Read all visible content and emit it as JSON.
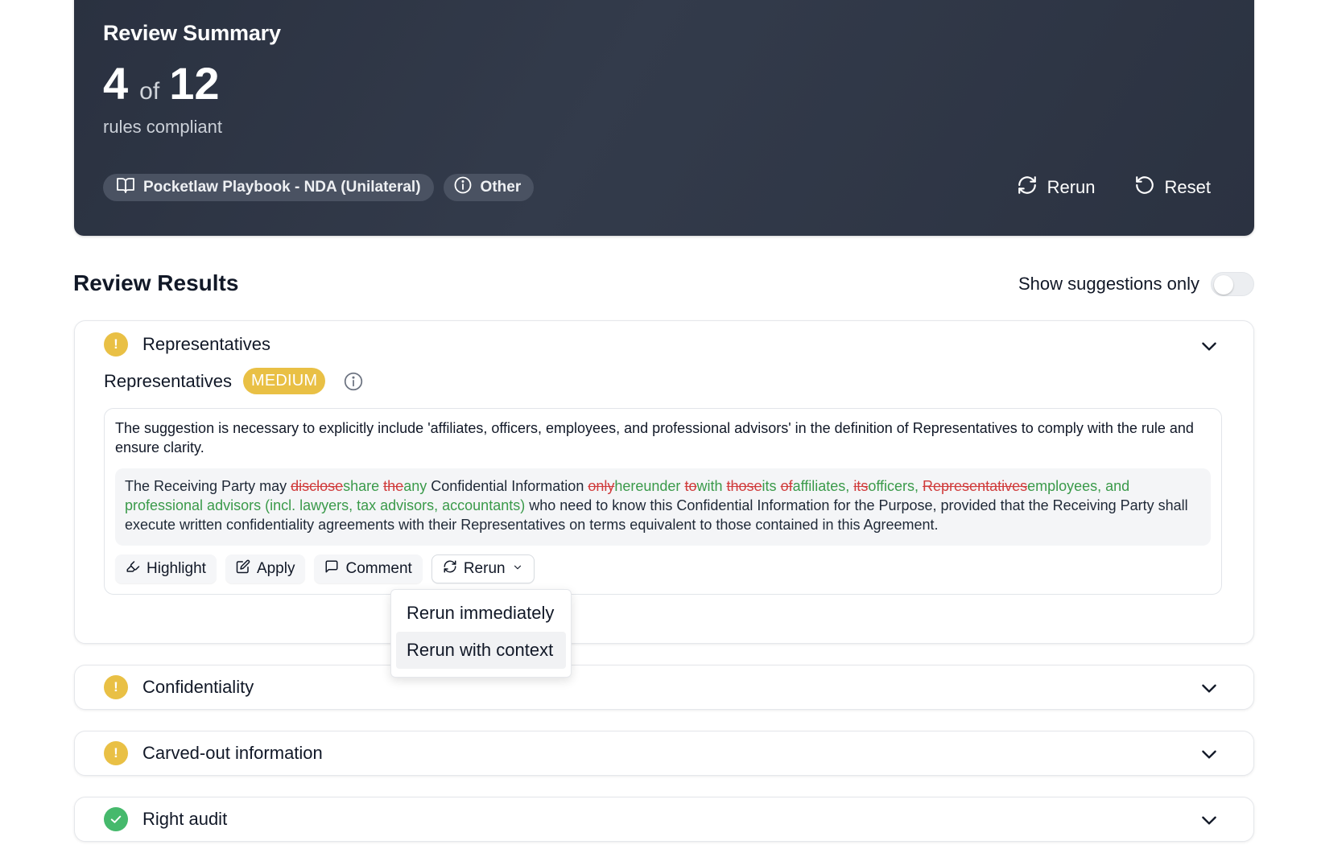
{
  "summary": {
    "title": "Review Summary",
    "compliant_count": "4",
    "of_label": "of",
    "total_count": "12",
    "subtitle": "rules compliant",
    "playbook_label": "Pocketlaw Playbook - NDA (Unilateral)",
    "category_label": "Other",
    "rerun_label": "Rerun",
    "reset_label": "Reset"
  },
  "results": {
    "title": "Review Results",
    "toggle_label": "Show suggestions only",
    "toggle_on": false
  },
  "rules": [
    {
      "title": "Representatives",
      "status": "warning",
      "expanded": true,
      "rule_name": "Representatives",
      "severity": "MEDIUM",
      "reason": "The suggestion is necessary to explicitly include 'affiliates, officers, employees, and professional advisors' in the definition of Representatives to comply with the rule and ensure clarity.",
      "redline": [
        {
          "t": "text",
          "v": "The Receiving Party may "
        },
        {
          "t": "del",
          "v": "disclose"
        },
        {
          "t": "ins",
          "v": "share"
        },
        {
          "t": "text",
          "v": " "
        },
        {
          "t": "del",
          "v": "the"
        },
        {
          "t": "ins",
          "v": "any"
        },
        {
          "t": "text",
          "v": " Confidential Information "
        },
        {
          "t": "del",
          "v": "only"
        },
        {
          "t": "ins",
          "v": "hereunder"
        },
        {
          "t": "text",
          "v": " "
        },
        {
          "t": "del",
          "v": "to"
        },
        {
          "t": "ins",
          "v": "with"
        },
        {
          "t": "text",
          "v": " "
        },
        {
          "t": "del",
          "v": "those"
        },
        {
          "t": "ins",
          "v": "its"
        },
        {
          "t": "text",
          "v": " "
        },
        {
          "t": "del",
          "v": "of"
        },
        {
          "t": "ins",
          "v": "affiliates,"
        },
        {
          "t": "text",
          "v": " "
        },
        {
          "t": "del",
          "v": "its"
        },
        {
          "t": "ins",
          "v": "officers,"
        },
        {
          "t": "text",
          "v": " "
        },
        {
          "t": "del",
          "v": "Representatives"
        },
        {
          "t": "ins",
          "v": "employees, and professional advisors (incl. lawyers, tax advisors, accountants)"
        },
        {
          "t": "text",
          "v": " who need to know this Confidential Information for the Purpose, provided that the Receiving Party shall execute written confidentiality agreements with their Representatives on terms equivalent to those contained in this Agreement."
        }
      ],
      "actions": {
        "highlight": "Highlight",
        "apply": "Apply",
        "comment": "Comment",
        "rerun": "Rerun"
      }
    },
    {
      "title": "Confidentiality",
      "status": "warning",
      "expanded": false
    },
    {
      "title": "Carved-out information",
      "status": "warning",
      "expanded": false
    },
    {
      "title": "Right audit",
      "status": "ok",
      "expanded": false
    }
  ],
  "rerun_menu": {
    "items": [
      "Rerun immediately",
      "Rerun with context"
    ],
    "highlighted_index": 1
  },
  "colors": {
    "warning": "#e9c045",
    "ok": "#46b96c",
    "deletion": "#d03b3b",
    "insertion": "#3a9a4a",
    "summary_bg": "#2f3646"
  }
}
